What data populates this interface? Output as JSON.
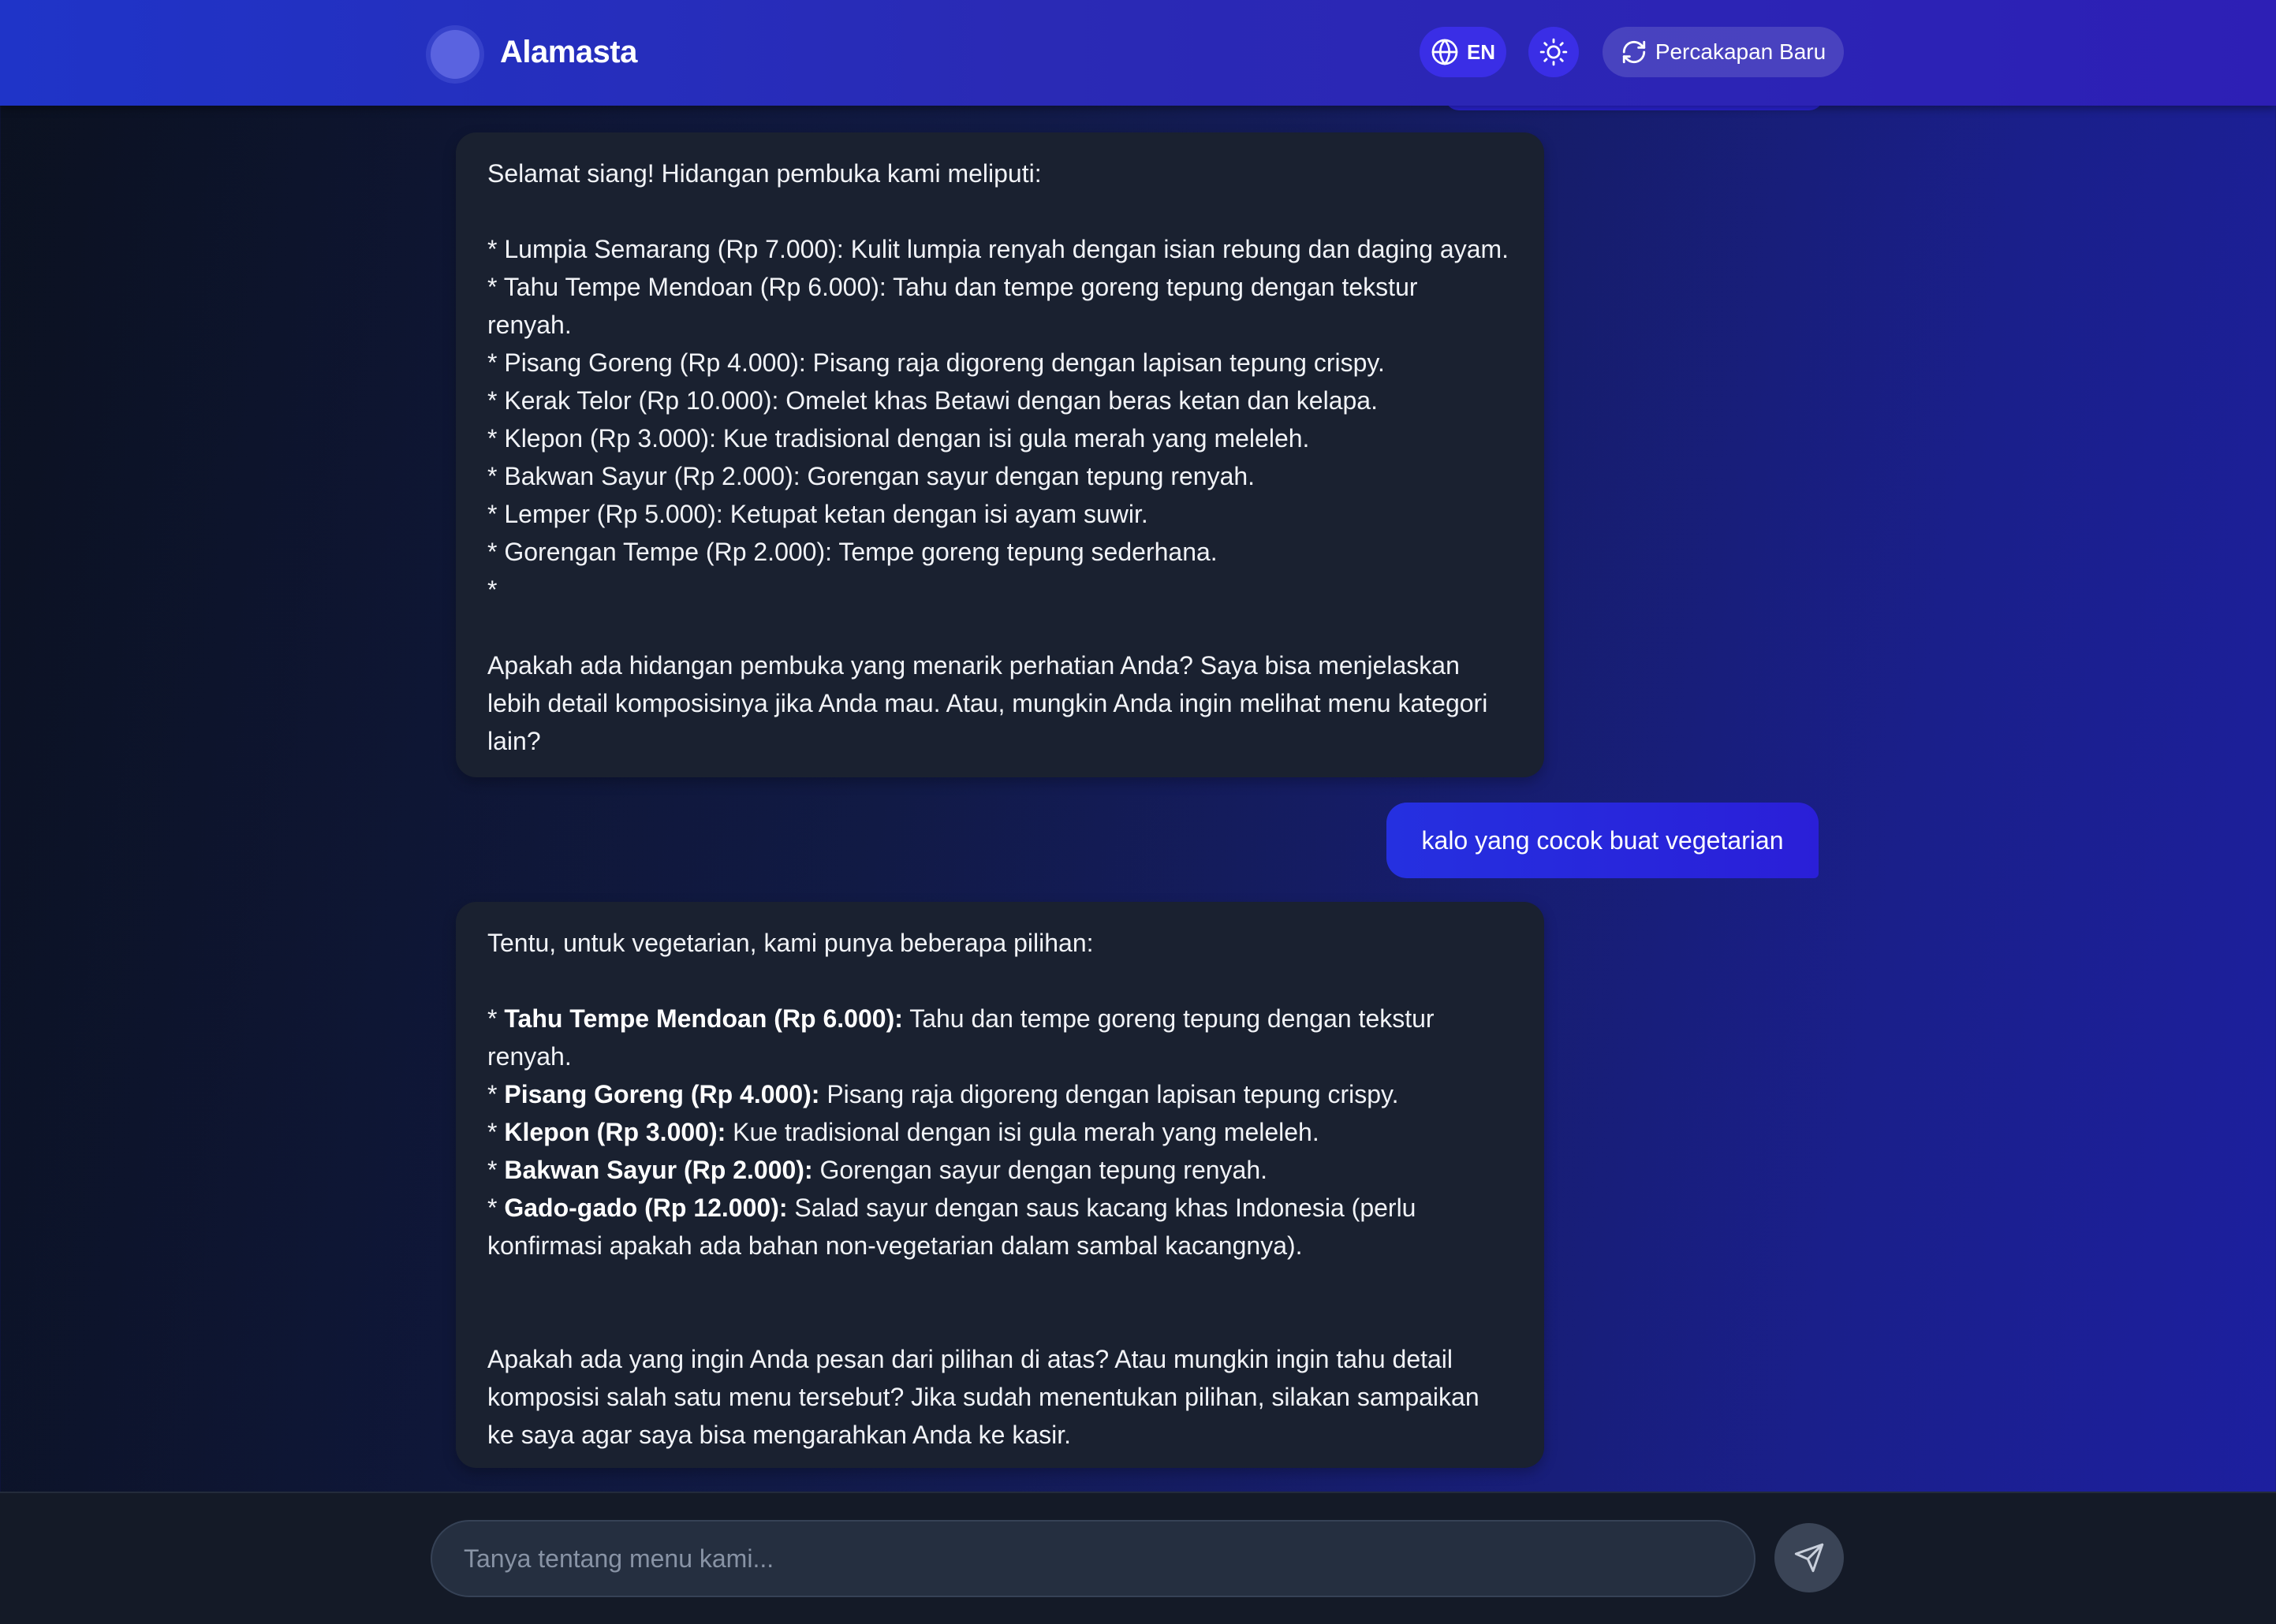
{
  "header": {
    "app_title": "Alamasta",
    "language_label": "EN",
    "new_chat_label": "Percakapan Baru"
  },
  "messages": [
    {
      "role": "assistant",
      "intro": "Selamat siang! Hidangan pembuka kami meliputi:",
      "items": [
        "* Lumpia Semarang (Rp 7.000): Kulit lumpia renyah dengan isian rebung dan daging ayam.",
        "* Tahu Tempe Mendoan (Rp 6.000): Tahu dan tempe goreng tepung dengan tekstur",
        "renyah.",
        "* Pisang Goreng (Rp 4.000): Pisang raja digoreng dengan lapisan tepung crispy.",
        "* Kerak Telor (Rp 10.000): Omelet khas Betawi dengan beras ketan dan kelapa.",
        "* Klepon (Rp 3.000): Kue tradisional dengan isi gula merah yang meleleh.",
        "* Bakwan Sayur (Rp 2.000): Gorengan sayur dengan tepung renyah.",
        "* Lemper (Rp 5.000): Ketupat ketan dengan isi ayam suwir.",
        "* Gorengan Tempe (Rp 2.000): Tempe goreng tepung sederhana.",
        "*"
      ],
      "closing": [
        "Apakah ada hidangan pembuka yang menarik perhatian Anda? Saya bisa menjelaskan",
        "lebih detail komposisinya jika Anda mau. Atau, mungkin Anda ingin melihat menu kategori",
        "lain?"
      ]
    },
    {
      "role": "user",
      "text": "kalo yang cocok buat vegetarian"
    },
    {
      "role": "assistant",
      "intro": "Tentu, untuk vegetarian, kami punya beberapa pilihan:",
      "items": [
        {
          "name": "Tahu Tempe Mendoan (Rp 6.000):",
          "desc": " Tahu dan tempe goreng tepung dengan tekstur"
        },
        {
          "name": "",
          "desc": "renyah."
        },
        {
          "name": "Pisang Goreng (Rp 4.000):",
          "desc": " Pisang raja digoreng dengan lapisan tepung crispy."
        },
        {
          "name": "Klepon (Rp 3.000):",
          "desc": " Kue tradisional dengan isi gula merah yang meleleh."
        },
        {
          "name": "Bakwan Sayur (Rp 2.000):",
          "desc": " Gorengan sayur dengan tepung renyah."
        },
        {
          "name": "Gado-gado (Rp 12.000):",
          "desc": " Salad sayur dengan saus kacang khas Indonesia (perlu"
        },
        {
          "name": "",
          "desc": "konfirmasi apakah ada bahan non-vegetarian dalam sambal kacangnya)."
        }
      ],
      "closing": [
        "Apakah ada yang ingin Anda pesan dari pilihan di atas? Atau mungkin ingin tahu detail",
        "komposisi salah satu menu tersebut? Jika sudah menentukan pilihan, silakan sampaikan",
        "ke saya agar saya bisa mengarahkan Anda ke kasir."
      ]
    }
  ],
  "input": {
    "placeholder": "Tanya tentang menu kami...",
    "value": ""
  },
  "icons": {
    "logo": "logo-icon",
    "language": "globe-icon",
    "theme": "sun-icon",
    "new_chat": "refresh-icon",
    "send": "send-icon"
  },
  "colors": {
    "header": "#2a2ab5",
    "accent": "#3a2ee6",
    "user_bubble": "#2530e0",
    "bot_bubble": "#1a2130",
    "footer": "#141a27"
  }
}
